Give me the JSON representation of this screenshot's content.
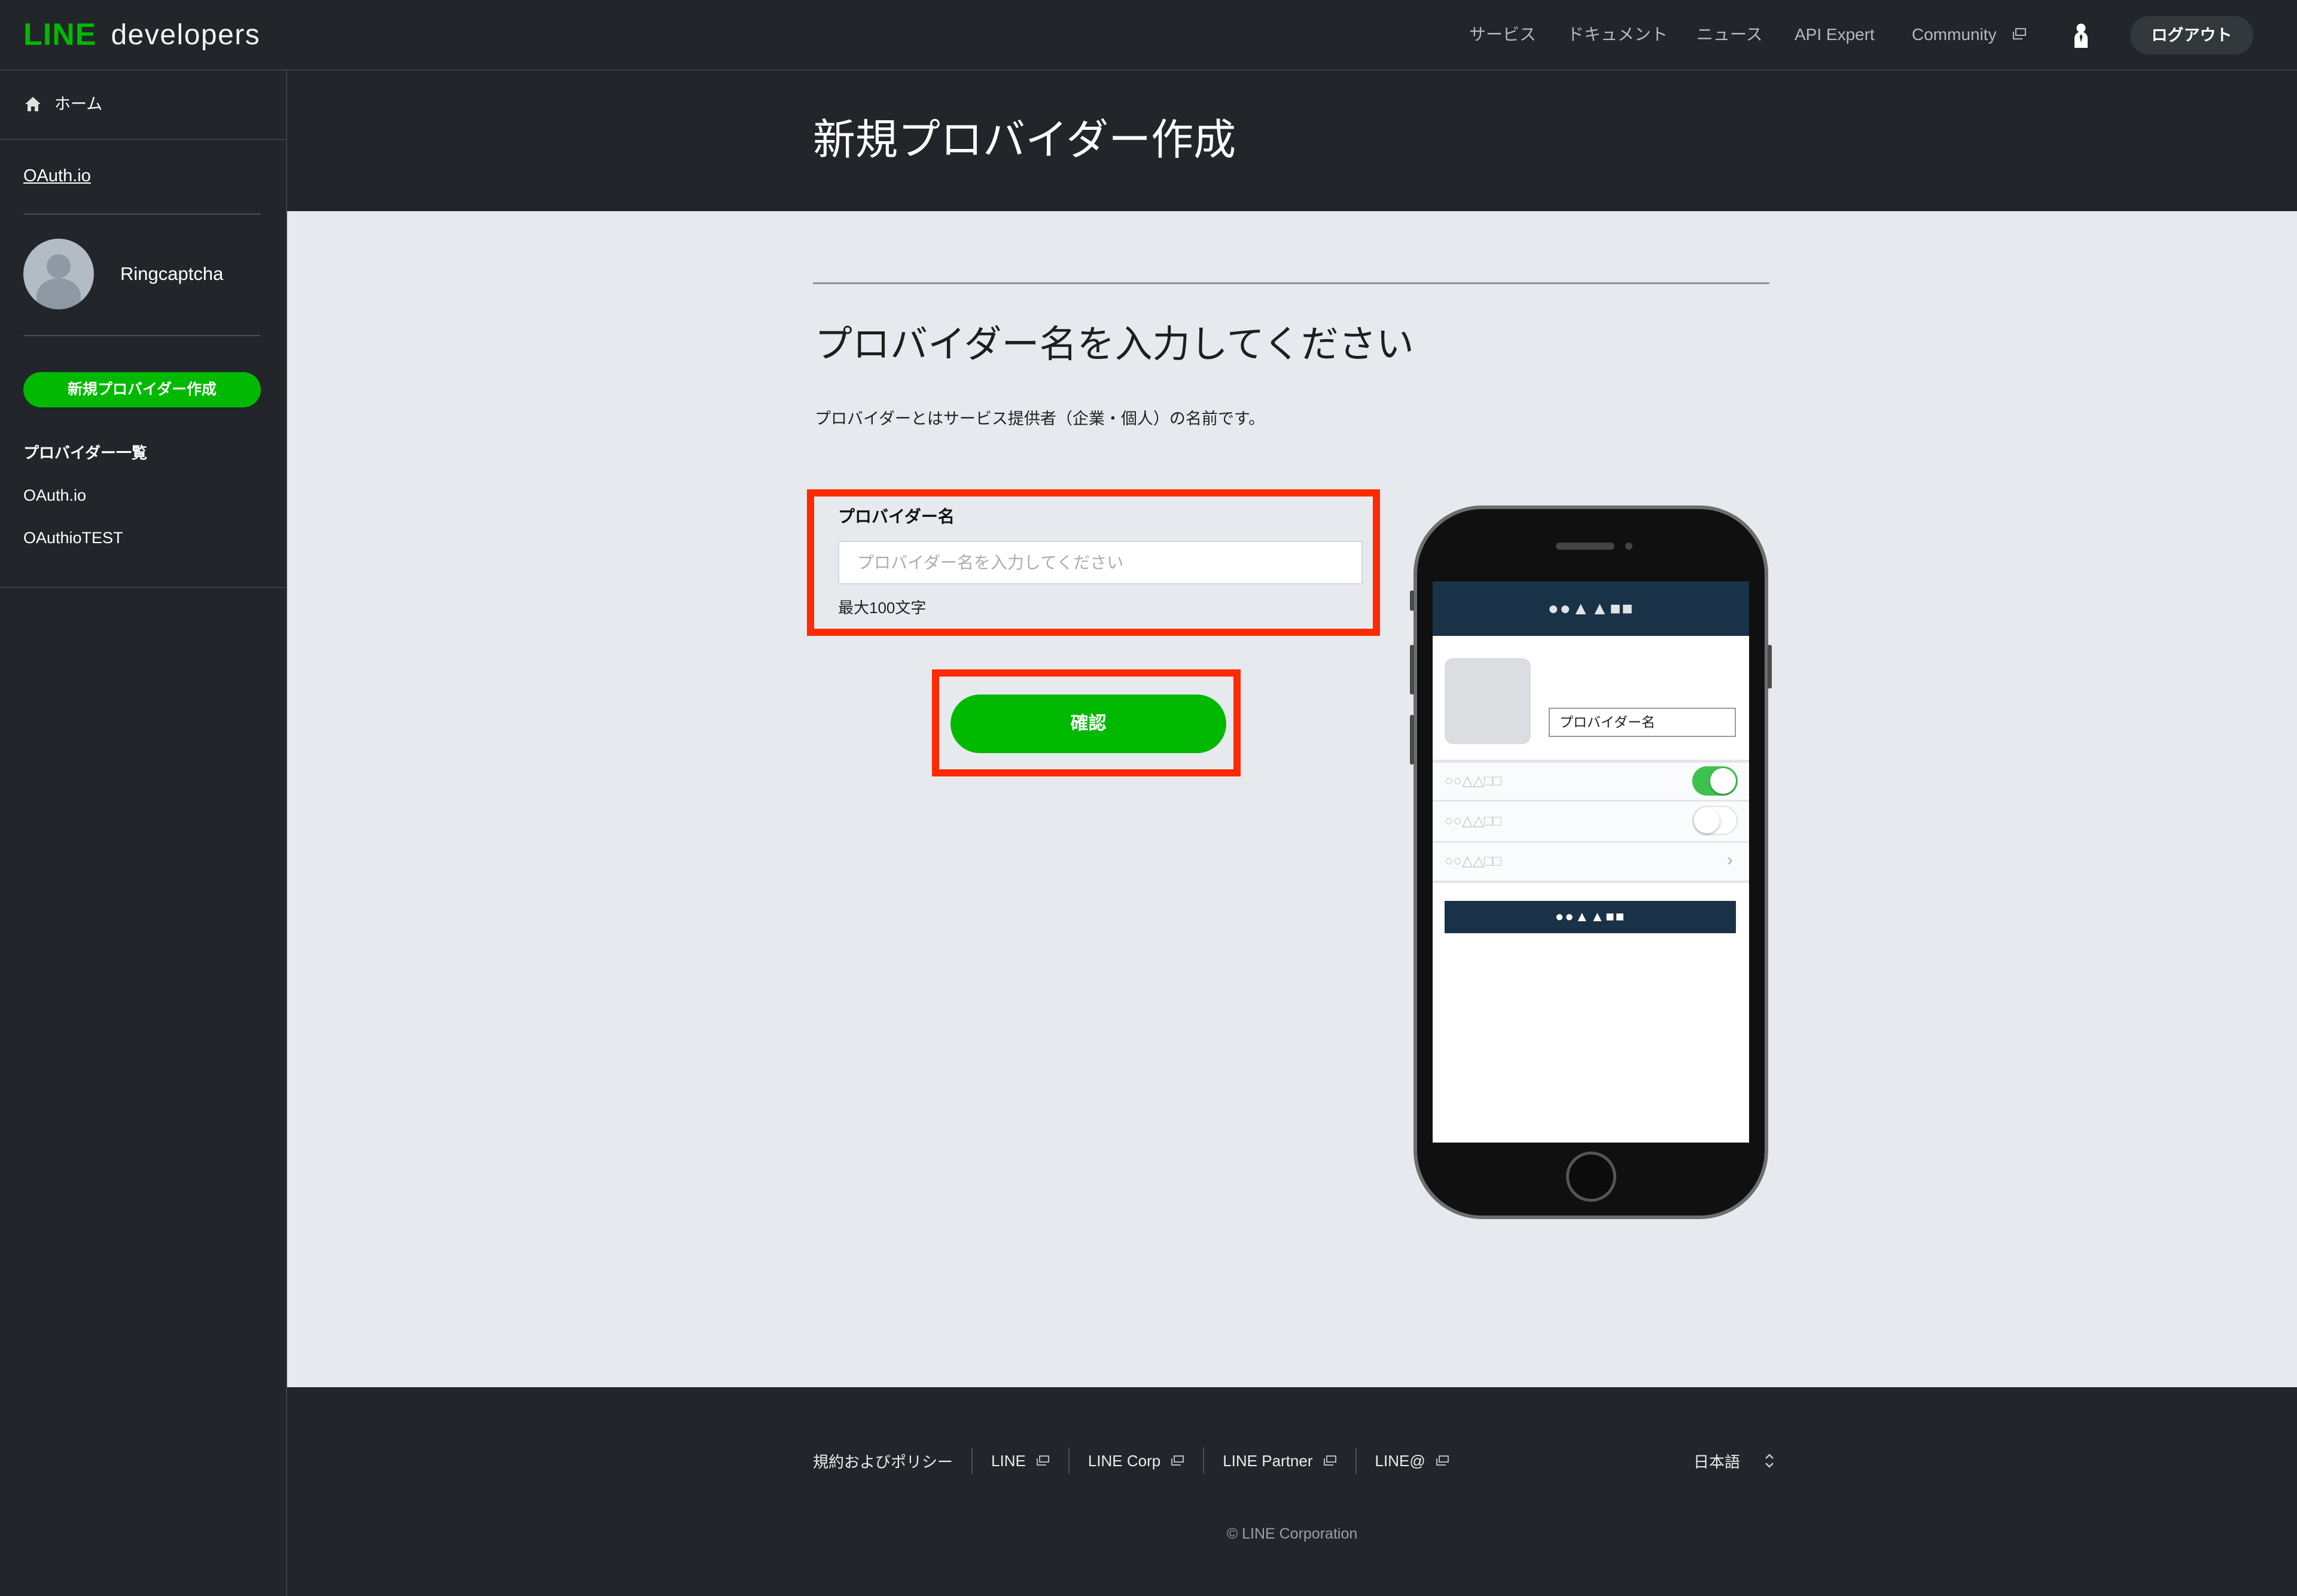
{
  "header": {
    "logo_brand": "LINE",
    "logo_product": "developers",
    "nav": [
      {
        "label": "サービス"
      },
      {
        "label": "ドキュメント"
      },
      {
        "label": "ニュース"
      },
      {
        "label": "API Expert"
      },
      {
        "label": "Community",
        "external": true,
        "icon": "external-link-icon"
      }
    ],
    "user_icon": "user-icon",
    "logout_label": "ログアウト"
  },
  "sidebar": {
    "home_icon": "home-icon",
    "home_label": "ホーム",
    "account_link": "OAuth.io",
    "user_name": "Ringcaptcha",
    "create_button": "新規プロバイダー作成",
    "providers_heading": "プロバイダー一覧",
    "providers": [
      {
        "label": "OAuth.io"
      },
      {
        "label": "OAuthioTEST"
      }
    ]
  },
  "page": {
    "title": "新規プロバイダー作成",
    "heading": "プロバイダー名を入力してください",
    "description": "プロバイダーとはサービス提供者（企業・個人）の名前です。",
    "form": {
      "label": "プロバイダー名",
      "placeholder": "プロバイダー名を入力してください",
      "value": "",
      "hint": "最大100文字",
      "submit": "確認"
    }
  },
  "preview": {
    "app_title": "●●▲▲■■",
    "name_field": "プロバイダー名",
    "rows": [
      {
        "label": "○○△△□□",
        "toggle": true
      },
      {
        "label": "○○△△□□",
        "toggle": false
      },
      {
        "label": "○○△△□□",
        "chevron": true
      }
    ],
    "button": "●●▲▲■■"
  },
  "footer": {
    "links": [
      {
        "label": "規約およびポリシー",
        "external": false
      },
      {
        "label": "LINE",
        "external": true
      },
      {
        "label": "LINE Corp",
        "external": true
      },
      {
        "label": "LINE Partner",
        "external": true
      },
      {
        "label": "LINE@",
        "external": true
      }
    ],
    "language": "日本語",
    "copyright": "© LINE Corporation"
  },
  "colors": {
    "brand_green": "#00b900",
    "highlight_red": "#ff2a00",
    "dark_bg": "#22262a",
    "content_bg": "#e6eaee",
    "preview_navy": "#1a3248",
    "toggle_on": "#3ec14e"
  }
}
